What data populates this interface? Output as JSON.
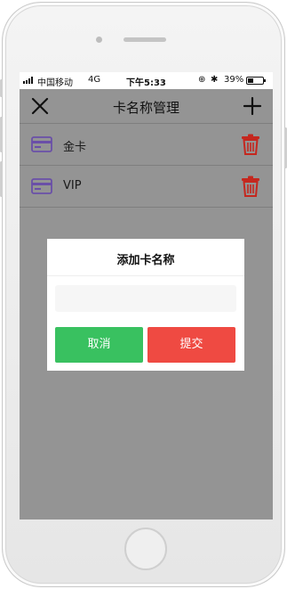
{
  "status_bar": {
    "carrier": "中国移动",
    "network": "4G",
    "time": "下午5:33",
    "battery_percent": "39%",
    "battery_level": 0.39
  },
  "navbar": {
    "title": "卡名称管理",
    "close_icon": "close-icon",
    "add_icon": "plus-icon"
  },
  "cards": [
    {
      "name": "金卡",
      "icon": "credit-card-icon",
      "action_icon": "trash-icon"
    },
    {
      "name": "VIP",
      "icon": "credit-card-icon",
      "action_icon": "trash-icon"
    }
  ],
  "dialog": {
    "title": "添加卡名称",
    "input_value": "",
    "input_placeholder": "",
    "cancel_label": "取消",
    "submit_label": "提交"
  },
  "colors": {
    "overlay": "#949494",
    "card_icon": "#6a4fa8",
    "trash_icon": "#c5271e",
    "cancel": "#39c160",
    "submit": "#ef4a42"
  }
}
